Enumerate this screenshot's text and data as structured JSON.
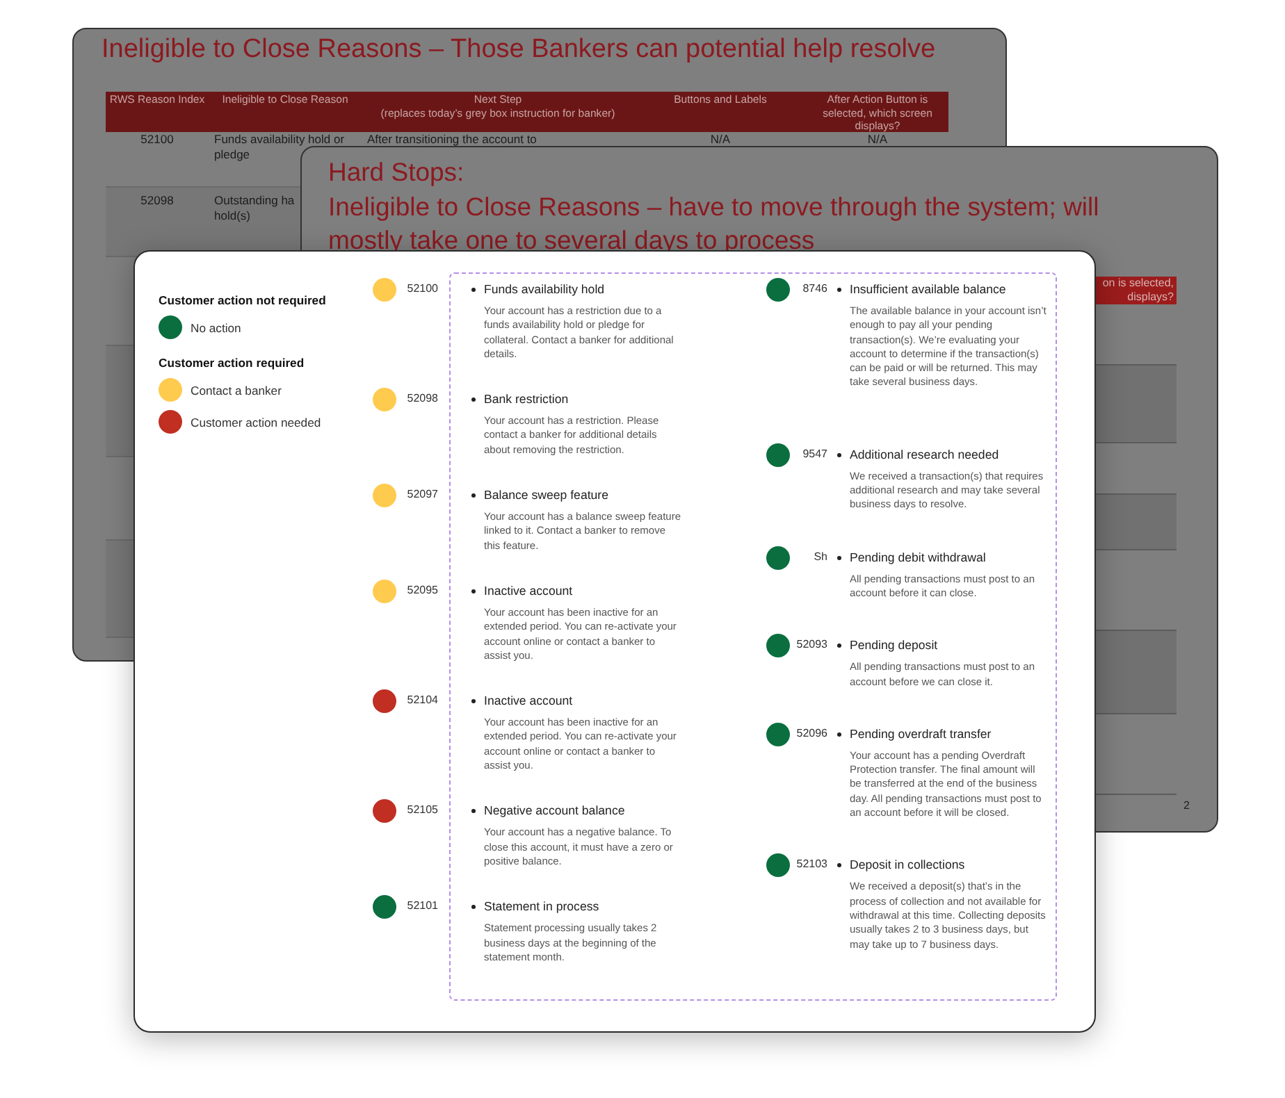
{
  "back_slide": {
    "title": "Ineligible to Close Reasons – Those Bankers can potential help resolve",
    "table": {
      "columns": [
        "RWS Reason Index",
        "Ineligible to Close Reason",
        "Next Step\n(replaces today’s grey box instruction for banker)",
        "Buttons and Labels",
        "After Action Button is selected, which screen displays?"
      ],
      "rows": [
        {
          "cells": [
            "52100",
            "Funds availability hold or pledge",
            "After transitioning the account to",
            "N/A",
            "N/A"
          ]
        },
        {
          "cells": [
            "52098",
            "Outstanding ha\nhold(s)"
          ]
        }
      ]
    }
  },
  "middle_slide": {
    "title_lines": [
      "Hard Stops:",
      "Ineligible to Close Reasons – have to move through the system; will",
      "mostly take one to several days to process"
    ],
    "table": {
      "header_lines": [
        "on is selected,",
        "displays?"
      ]
    },
    "page_number": "2"
  },
  "front_card": {
    "legend": [
      {
        "heading": "Customer action not required",
        "items": [
          {
            "label": "No action",
            "color": "#0a6e3f"
          }
        ]
      },
      {
        "heading": "Customer action required",
        "items": [
          {
            "label": "Contact a banker",
            "color": "#fecb4f"
          },
          {
            "label": "Customer action needed",
            "color": "#c02f22"
          }
        ]
      }
    ],
    "columns": [
      {
        "items": [
          {
            "code": "52100",
            "title": "Funds availability hold",
            "description": "Your account has a restriction due to a funds availability hold or pledge for collateral. Contact a banker for additional details.",
            "color": "#fecb4f"
          },
          {
            "code": "52098",
            "title": "Bank restriction",
            "description": "Your account has a restriction. Please contact a banker for additional details about removing the restriction.",
            "color": "#fecb4f"
          },
          {
            "code": "52097",
            "title": "Balance sweep feature",
            "description": "Your account has a balance sweep feature linked to it. Contact a banker to remove this feature.",
            "color": "#fecb4f"
          },
          {
            "code": "52095",
            "title": "Inactive account",
            "description": "Your account has been inactive for an extended period. You can re-activate your account online or contact a banker to assist you.",
            "color": "#fecb4f"
          },
          {
            "code": "52104",
            "title": "Inactive account",
            "description": "Your account has been inactive for an extended period. You can re-activate your account online or contact a banker to assist you.",
            "color": "#c02f22"
          },
          {
            "code": "52105",
            "title": "Negative account balance",
            "description": "Your account has a negative balance. To close this account, it must have a zero or positive balance.",
            "color": "#c02f22"
          },
          {
            "code": "52101",
            "title": "Statement in process",
            "description": "Statement processing usually takes 2 business days at the beginning of the statement month.",
            "color": "#0a6e3f"
          }
        ]
      },
      {
        "items": [
          {
            "code": "8746",
            "title": "Insufficient available balance",
            "description": "The available balance in your account isn’t enough to pay all your pending transaction(s). We’re evaluating your account to determine if the transaction(s) can be paid or will be returned. This may take several business days.",
            "color": "#0a6e3f"
          },
          {
            "code": "9547",
            "title": "Additional research needed",
            "description": "We received a transaction(s) that requires additional research and may take several business days to resolve.",
            "color": "#0a6e3f"
          },
          {
            "code": "Sh",
            "title": "Pending debit withdrawal",
            "description": "All pending transactions must post to an account before it can close.",
            "color": "#0a6e3f"
          },
          {
            "code": "52093",
            "title": "Pending deposit",
            "description": "All pending transactions must post to an account before we can close it.",
            "color": "#0a6e3f"
          },
          {
            "code": "52096",
            "title": "Pending overdraft transfer",
            "description": "Your account has a pending Overdraft Protection transfer. The final amount will be transferred at the end of the business day. All pending transactions must post to an account before it will be closed.",
            "color": "#0a6e3f"
          },
          {
            "code": "52103",
            "title": "Deposit in collections",
            "description": "We received a deposit(s) that’s in the process of collection and not available for withdrawal at this time. Collecting deposits usually takes 2 to 3 business days, but may take up to 7 business days.",
            "color": "#0a6e3f"
          }
        ]
      }
    ]
  }
}
